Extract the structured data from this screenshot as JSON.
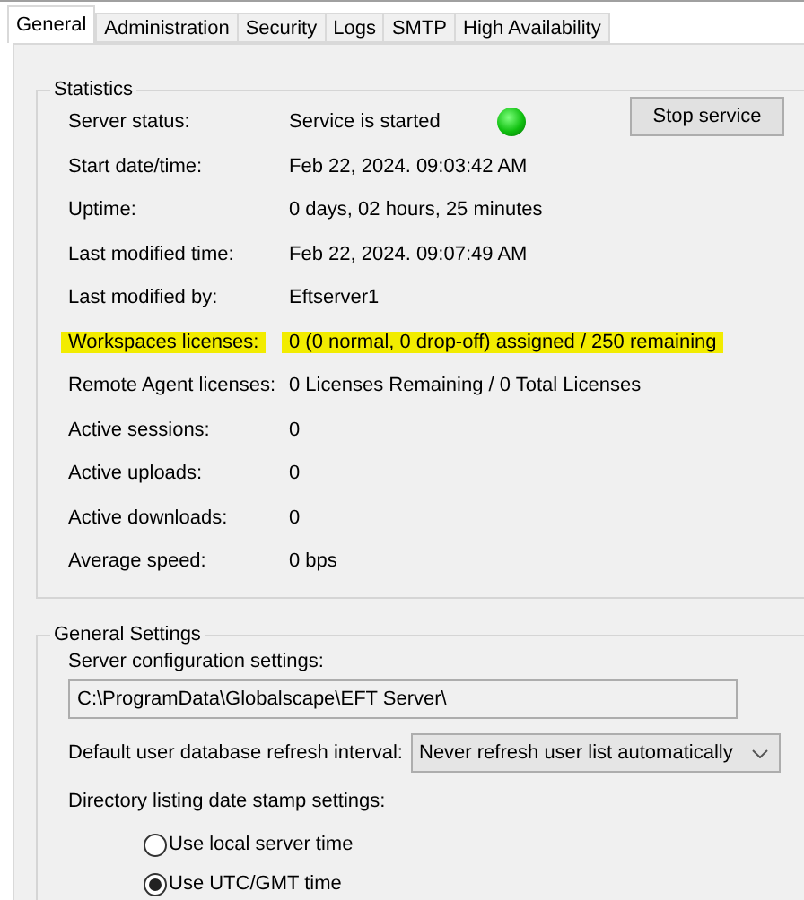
{
  "tabs": [
    {
      "label": "General",
      "selected": true
    },
    {
      "label": "Administration",
      "selected": false
    },
    {
      "label": "Security",
      "selected": false
    },
    {
      "label": "Logs",
      "selected": false
    },
    {
      "label": "SMTP",
      "selected": false
    },
    {
      "label": "High Availability",
      "selected": false
    }
  ],
  "statistics": {
    "title": "Statistics",
    "server_status": {
      "label": "Server status:",
      "value": "Service is started",
      "running": true
    },
    "stop_button": "Stop service",
    "rows": [
      {
        "label": "Start date/time:",
        "value": "Feb 22, 2024. 09:03:42 AM",
        "highlighted": false
      },
      {
        "label": "Uptime:",
        "value": "0 days, 02 hours, 25 minutes",
        "highlighted": false
      },
      {
        "label": "Last modified time:",
        "value": "Feb 22, 2024. 09:07:49 AM",
        "highlighted": false
      },
      {
        "label": "Last modified by:",
        "value": "Eftserver1",
        "highlighted": false
      },
      {
        "label": "Workspaces licenses:",
        "value": "0 (0 normal, 0 drop-off) assigned / 250 remaining",
        "highlighted": true
      },
      {
        "label": "Remote Agent licenses:",
        "value": "0 Licenses Remaining / 0 Total Licenses",
        "highlighted": false
      },
      {
        "label": "Active sessions:",
        "value": "0",
        "highlighted": false
      },
      {
        "label": "Active uploads:",
        "value": "0",
        "highlighted": false
      },
      {
        "label": "Active downloads:",
        "value": "0",
        "highlighted": false
      },
      {
        "label": "Average speed:",
        "value": "0 bps",
        "highlighted": false
      }
    ]
  },
  "general_settings": {
    "title": "General Settings",
    "config_label": "Server configuration settings:",
    "config_path": "C:\\ProgramData\\Globalscape\\EFT Server\\",
    "refresh_label": "Default user database refresh interval:",
    "refresh_value": "Never refresh user list automatically",
    "datestamp_label": "Directory listing date stamp settings:",
    "datestamp_options": [
      {
        "label": "Use local server time",
        "selected": false
      },
      {
        "label": "Use UTC/GMT time",
        "selected": true
      }
    ]
  }
}
